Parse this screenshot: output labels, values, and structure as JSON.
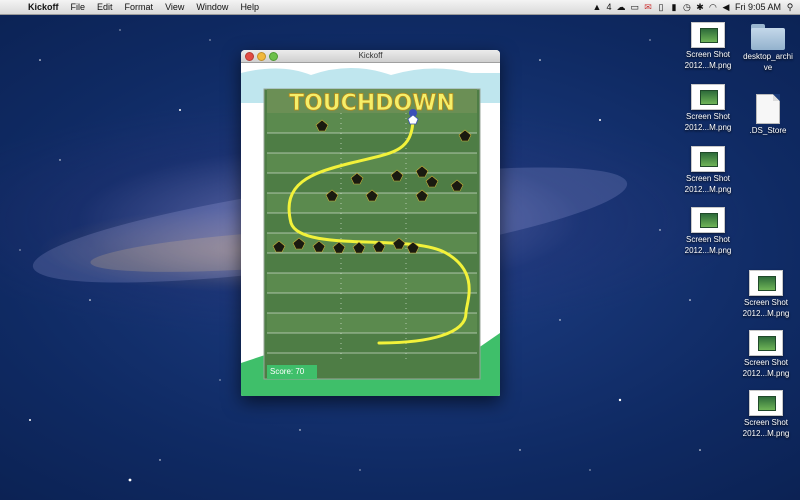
{
  "menubar": {
    "apple_icon": "apple-icon",
    "app_name": "Kickoff",
    "menus": [
      "File",
      "Edit",
      "Format",
      "View",
      "Window",
      "Help"
    ],
    "status_icons": [
      "adobe-icon",
      "cloud-icon",
      "window-icon",
      "mail-icon",
      "clipboard-icon",
      "battery-icon",
      "clock-icon",
      "bluetooth-icon",
      "wifi-icon",
      "volume-icon"
    ],
    "adobe_count": "4",
    "clock": "Fri 9:05 AM"
  },
  "window": {
    "title": "Kickoff",
    "game": {
      "banner": "TOUCHDOWN",
      "score_label": "Score: 70",
      "colors": {
        "field_dark": "#3f6a3a",
        "field_light": "#5b8a4e",
        "grass": "#3fbf6a",
        "sky": "#bfe6ee",
        "path": "#f2f23a",
        "banner": "#f5ef6a"
      }
    }
  },
  "desktop": {
    "icons": [
      {
        "name": "screenshot-1",
        "label1": "Screen Shot",
        "label2": "2012...M.png"
      },
      {
        "name": "folder-desktop-archive",
        "label1": "desktop_archi",
        "label2": "ve"
      },
      {
        "name": "screenshot-2",
        "label1": "Screen Shot",
        "label2": "2012...M.png"
      },
      {
        "name": "file-ds-store",
        "label1": ".DS_Store",
        "label2": ""
      },
      {
        "name": "screenshot-3",
        "label1": "Screen Shot",
        "label2": "2012...M.png"
      },
      {
        "name": "screenshot-4",
        "label1": "Screen Shot",
        "label2": "2012...M.png"
      },
      {
        "name": "screenshot-5",
        "label1": "Screen Shot",
        "label2": "2012...M.png"
      },
      {
        "name": "screenshot-6",
        "label1": "Screen Shot",
        "label2": "2012...M.png"
      },
      {
        "name": "screenshot-7",
        "label1": "Screen Shot",
        "label2": "2012...M.png"
      }
    ]
  }
}
